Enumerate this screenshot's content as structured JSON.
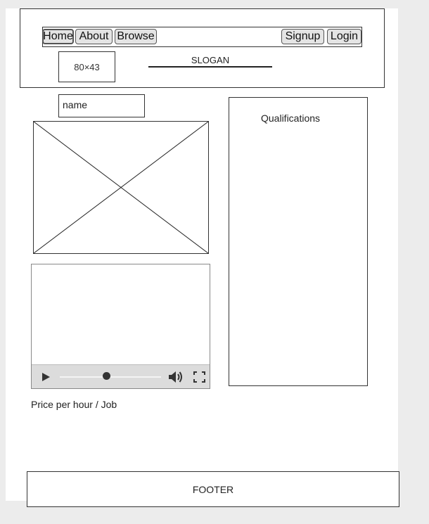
{
  "header": {
    "nav": {
      "home": "Home",
      "about": "About",
      "browse": "Browse",
      "signup": "Signup",
      "login": "Login"
    },
    "logo_text": "80×43",
    "slogan": "SLOGAN"
  },
  "profile": {
    "name_label": "name",
    "price_label": "Price per hour / Job"
  },
  "video": {
    "progress_fraction": 0.46
  },
  "qualifications": {
    "title": "Qualifications"
  },
  "footer": {
    "text": "FOOTER"
  }
}
